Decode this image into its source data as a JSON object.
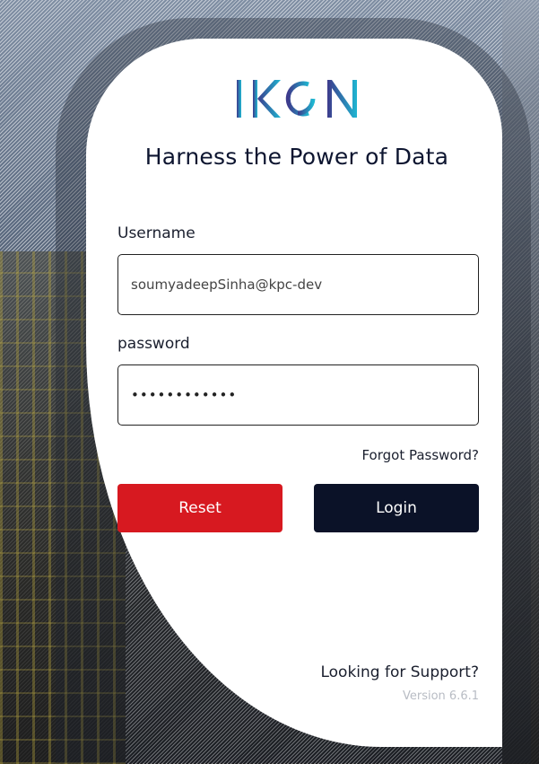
{
  "brand": {
    "logo_text": "IKON",
    "colors": {
      "logo_start": "#3d3a8c",
      "logo_end": "#1fb6d1",
      "reset": "#d71920",
      "login": "#0b1228"
    }
  },
  "login": {
    "headline": "Harness the Power of Data",
    "username_label": "Username",
    "username_value": "soumyadeepSinha@kpc-dev",
    "password_label": "password",
    "password_value": "••••••••••••",
    "forgot_password": "Forgot Password?",
    "reset_button": "Reset",
    "login_button": "Login"
  },
  "footer": {
    "support": "Looking for Support?",
    "version": "Version 6.6.1"
  }
}
